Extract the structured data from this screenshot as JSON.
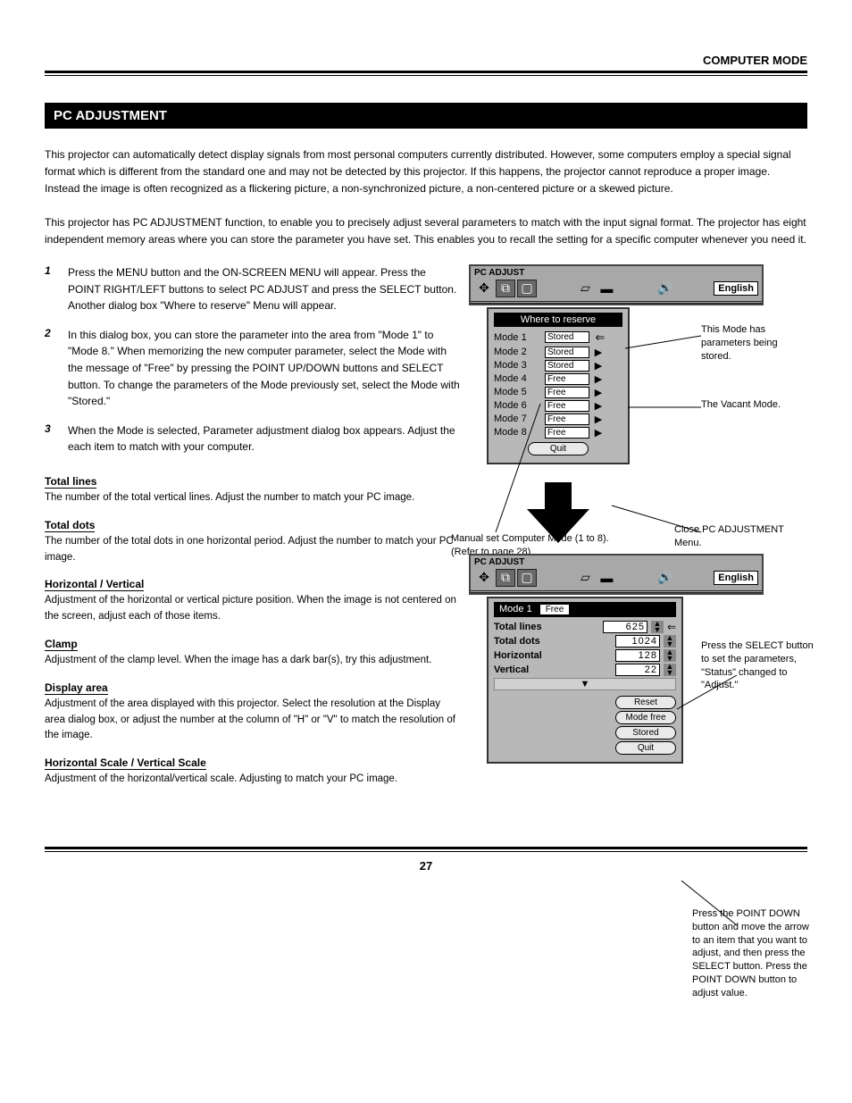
{
  "header_section": "COMPUTER MODE",
  "section_title": "PC ADJUSTMENT",
  "intro": "This projector can automatically detect display signals from most personal computers currently distributed. However, some computers employ a special signal format which is different from the standard one and may not be detected by this projector. If this happens, the projector cannot reproduce a proper image. Instead the image is often recognized as a flickering picture, a non-synchronized picture, a non-centered picture or a skewed picture.",
  "intro2": "This projector has PC ADJUSTMENT function, to enable you to precisely adjust several parameters to match with the input signal format. The projector has eight independent memory areas where you can store the parameter you have set. This enables you to recall the setting for a specific computer whenever you need it.",
  "steps": [
    {
      "n": "1",
      "t": "Press the MENU button and the ON-SCREEN MENU will appear. Press the POINT RIGHT/LEFT buttons to select PC ADJUST and press the SELECT button. Another dialog box \"Where to reserve\" Menu will appear."
    },
    {
      "n": "2",
      "t": "In this dialog box, you can store the parameter into the area from \"Mode 1\" to \"Mode 8.\" When memorizing the new computer parameter, select the Mode with the message of \"Free\" by pressing the POINT UP/DOWN buttons and SELECT button. To change the parameters of the Mode previously set, select the Mode with \"Stored.\""
    },
    {
      "n": "3",
      "t": "When the Mode is selected, Parameter adjustment dialog box appears. Adjust the each item to match with your computer."
    }
  ],
  "items": [
    {
      "label": "Total lines",
      "desc": "The number of the total vertical lines. Adjust the number to match your PC image."
    },
    {
      "label": "Total dots",
      "desc": "The number of the total dots in one horizontal period. Adjust the number to match your PC image."
    },
    {
      "label": "Horizontal / Vertical",
      "desc": "Adjustment of the horizontal or vertical picture position. When the image is not centered on the screen, adjust each of those items."
    },
    {
      "label": "Clamp",
      "desc": "Adjustment of the clamp level. When the image has a dark bar(s), try this adjustment."
    },
    {
      "label": "Display area",
      "desc": "Adjustment of the area displayed with this projector. Select the resolution at the Display area dialog box, or adjust the number at the column of \"H\" or \"V\" to match the resolution of the image."
    },
    {
      "label": "Horizontal Scale / Vertical Scale",
      "desc": "Adjustment of the horizontal/vertical scale. Adjusting to match your PC image."
    }
  ],
  "menubar": {
    "title": "PC ADJUST",
    "lang": "English"
  },
  "dialog1": {
    "header": "Where to reserve",
    "modes": [
      {
        "name": "Mode 1",
        "state": "Stored",
        "active": true
      },
      {
        "name": "Mode 2",
        "state": "Stored"
      },
      {
        "name": "Mode 3",
        "state": "Stored"
      },
      {
        "name": "Mode 4",
        "state": "Free"
      },
      {
        "name": "Mode 5",
        "state": "Free"
      },
      {
        "name": "Mode 6",
        "state": "Free"
      },
      {
        "name": "Mode 7",
        "state": "Free"
      },
      {
        "name": "Mode 8",
        "state": "Free"
      }
    ],
    "quit": "Quit"
  },
  "dialog2": {
    "mode_label": "Mode 1",
    "mode_state": "Free",
    "params": [
      {
        "label": "Total lines",
        "value": "625"
      },
      {
        "label": "Total dots",
        "value": "1024"
      },
      {
        "label": "Horizontal",
        "value": "128"
      },
      {
        "label": "Vertical",
        "value": "22"
      }
    ],
    "buttons": [
      "Reset",
      "Mode free",
      "Stored",
      "Quit"
    ]
  },
  "callouts": {
    "c1": "This Mode has parameters being stored.",
    "c2": "The Vacant Mode.",
    "c3": "Manual set Computer Mode (1 to 8). (Refer to page 28)",
    "c4": "Close PC ADJUSTMENT Menu.",
    "c5": "Press the SELECT button to set the parameters, \"Status\" changed to \"Adjust.\"",
    "c6": "Press the POINT DOWN button and move the arrow to an item that you want to adjust, and then press the SELECT button. Press the POINT DOWN button to adjust value."
  },
  "footer": {
    "icon_label": "⬜",
    "page": "27"
  }
}
